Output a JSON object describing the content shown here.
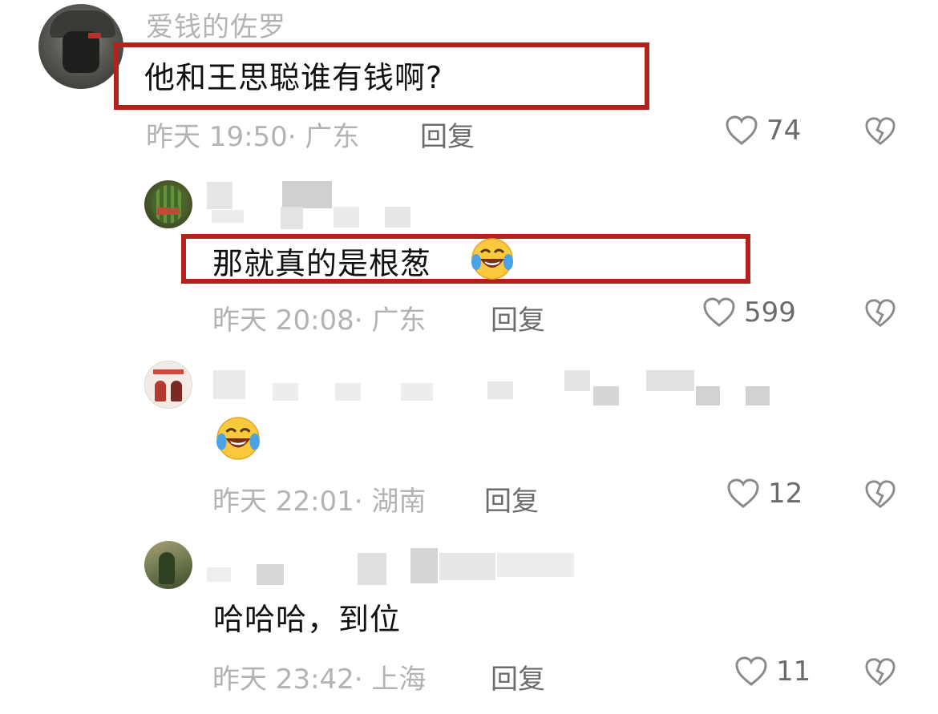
{
  "comments": [
    {
      "username": "爱钱的佐罗",
      "text": "他和王思聪谁有钱啊?",
      "time": "昨天 19:50",
      "location": "广东",
      "reply_label": "回复",
      "likes": "74",
      "highlighted": true
    }
  ],
  "replies": [
    {
      "username": "",
      "text": "那就真的是根葱",
      "time": "昨天 20:08",
      "location": "广东",
      "reply_label": "回复",
      "likes": "599",
      "highlighted": true,
      "trailing_emoji": "laugh-crying-emoji"
    },
    {
      "username": "",
      "text": "",
      "time": "昨天 22:01",
      "location": "湖南",
      "reply_label": "回复",
      "likes": "12",
      "highlighted": false,
      "emoji_only": "laugh-crying-emoji"
    },
    {
      "username": "",
      "text": "哈哈哈，到位",
      "time": "昨天 23:42",
      "location": "上海",
      "reply_label": "回复",
      "likes": "11",
      "highlighted": false
    }
  ],
  "icons": {
    "like": "heart-outline-icon",
    "dislike": "broken-heart-icon"
  },
  "colors": {
    "highlight_box": "#b3211c",
    "meta_text": "#b3b3b3",
    "action_text": "#6b6b6b"
  }
}
